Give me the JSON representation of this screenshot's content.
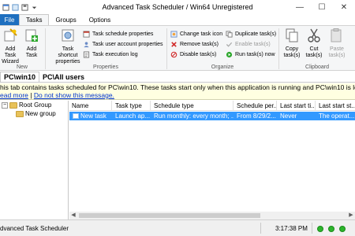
{
  "window": {
    "title": "Advanced Task Scheduler / Win64 Unregistered",
    "controls": [
      "minimize-icon",
      "maximize-icon",
      "close-icon"
    ]
  },
  "tabs": {
    "file": "File",
    "items": [
      "Tasks",
      "Groups",
      "Options"
    ],
    "active": "Tasks"
  },
  "ribbon": {
    "new": {
      "label": "New",
      "add_task_wizard": "Add Task Wizard",
      "add_task": "Add Task"
    },
    "properties": {
      "label": "Properties",
      "task_shortcut_properties": "Task shortcut properties",
      "task_schedule_properties": "Task schedule properties",
      "task_user_account_properties": "Task user account properties",
      "task_execution_log": "Task execution log"
    },
    "organize": {
      "label": "Organize",
      "change_task_icon": "Change task icon",
      "remove_tasks": "Remove task(s)",
      "disable_tasks": "Disable task(s)",
      "duplicate_tasks": "Duplicate task(s)",
      "enable_tasks": "Enable task(s)",
      "run_tasks_now": "Run task(s) now"
    },
    "clipboard": {
      "label": "Clipboard",
      "copy_tasks": "Copy task(s)",
      "cut_tasks": "Cut task(s)",
      "paste_tasks": "Paste task(s)"
    }
  },
  "section_tabs": [
    "PC\\win10",
    "PC\\All users"
  ],
  "infobar": {
    "text": "his tab contains tasks scheduled for PC\\win10. These tasks start only when this application is running and PC\\win10 is logged on.",
    "read_more": "ead more",
    "separator": " | ",
    "dont_show": "Do not show this message."
  },
  "tree": {
    "root": "Root Group",
    "child": "New group"
  },
  "table": {
    "columns": [
      "Name",
      "Task type",
      "Schedule type",
      "Schedule per...",
      "Last start ti...",
      "Last start st..."
    ],
    "rows": [
      {
        "name": "New task",
        "task_type": "Launch ap...",
        "schedule_type": "Run monthly: every month; ...",
        "schedule_period": "From 8/29/2...",
        "last_start_time": "Never",
        "last_start_status": "The operat..."
      }
    ]
  },
  "statusbar": {
    "app": "dvanced Task Scheduler",
    "time": "3:17:38 PM"
  },
  "colors": {
    "accent": "#1e6fbf",
    "selection": "#3399ff",
    "infobar": "#ffffe1",
    "status_ok": "#2cb52c"
  }
}
